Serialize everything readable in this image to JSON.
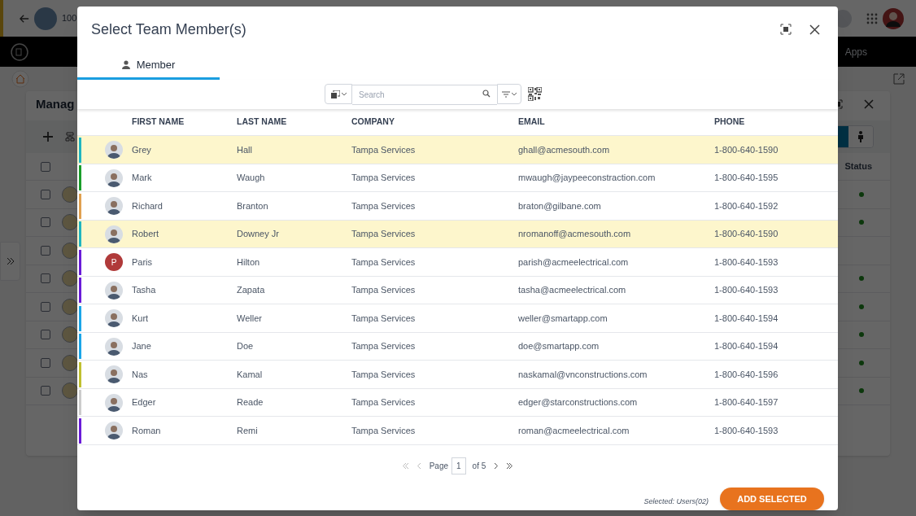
{
  "backdrop": {
    "header_text": "100",
    "nav_text": "Apps",
    "page_title": "Manag",
    "status_heading": "Status",
    "view_modes": [
      {
        "selected": true
      },
      {
        "selected": false
      }
    ],
    "all_checked": false,
    "rows": [
      {
        "checked": false,
        "status": true
      },
      {
        "checked": false,
        "status": true
      },
      {
        "checked": false,
        "status": false
      },
      {
        "checked": false,
        "status": true
      },
      {
        "checked": false,
        "status": true
      },
      {
        "checked": false,
        "status": true
      },
      {
        "checked": false,
        "status": true
      },
      {
        "checked": false,
        "status": true
      }
    ]
  },
  "dialog": {
    "title": "Select Team Member(s)",
    "tabs": [
      {
        "label": "Member",
        "selected": true
      }
    ],
    "search": {
      "placeholder": "Search"
    },
    "columns": [
      "FIRST NAME",
      "LAST NAME",
      "COMPANY",
      "EMAIL",
      "PHONE"
    ],
    "rows": [
      {
        "first": "Grey",
        "last": "Hall",
        "company": "Tampa Services",
        "email": "ghall@acmesouth.com",
        "phone": "1-800-640-1590",
        "selected": true,
        "color": "#1fb5c0",
        "kind": "photo"
      },
      {
        "first": "Mark",
        "last": "Waugh",
        "company": "Tampa Services",
        "email": "mwaugh@jaypeeconstraction.com",
        "phone": "1-800-640-1595",
        "selected": false,
        "color": "#1a9e2a",
        "kind": "photo"
      },
      {
        "first": "Richard",
        "last": "Branton",
        "company": "Tampa Services",
        "email": "braton@gilbane.com",
        "phone": "1-800-640-1592",
        "selected": false,
        "color": "#e0a050",
        "kind": "photo"
      },
      {
        "first": "Robert",
        "last": "Downey Jr",
        "company": "Tampa Services",
        "email": "nromanoff@acmesouth.com",
        "phone": "1-800-640-1590",
        "selected": true,
        "color": "#1fb5c0",
        "kind": "photo"
      },
      {
        "first": "Paris",
        "last": "Hilton",
        "company": "Tampa Services",
        "email": "parish@acmeelectrical.com",
        "phone": "1-800-640-1593",
        "selected": false,
        "color": "#6a1bd8",
        "kind": "initial",
        "initial": "P"
      },
      {
        "first": "Tasha",
        "last": "Zapata",
        "company": "Tampa Services",
        "email": "tasha@acmeelectrical.com",
        "phone": "1-800-640-1593",
        "selected": false,
        "color": "#6a1bd8",
        "kind": "photo"
      },
      {
        "first": "Kurt",
        "last": "Weller",
        "company": "Tampa Services",
        "email": "weller@smartapp.com",
        "phone": "1-800-640-1594",
        "selected": false,
        "color": "#1aa5e8",
        "kind": "photo"
      },
      {
        "first": "Jane",
        "last": "Doe",
        "company": "Tampa Services",
        "email": "doe@smartapp.com",
        "phone": "1-800-640-1594",
        "selected": false,
        "color": "#1aa5e8",
        "kind": "photo"
      },
      {
        "first": "Nas",
        "last": "Kamal",
        "company": "Tampa Services",
        "email": "naskamal@vnconstructions.com",
        "phone": "1-800-640-1596",
        "selected": false,
        "color": "#c0c030",
        "kind": "photo"
      },
      {
        "first": "Edger",
        "last": "Reade",
        "company": "Tampa Services",
        "email": "edger@starconstructions.com",
        "phone": "1-800-640-1597",
        "selected": false,
        "color": "#cccccc",
        "kind": "photo"
      },
      {
        "first": "Roman",
        "last": "Remi",
        "company": "Tampa Services",
        "email": "roman@acmeelectrical.com",
        "phone": "1-800-640-1593",
        "selected": false,
        "color": "#6a1bd8",
        "kind": "photo"
      }
    ],
    "pagination": {
      "page_label": "Page",
      "page": "1",
      "of_label": "of",
      "total": "5"
    },
    "selection_note": "Selected: Users(02)",
    "add_button": "ADD SELECTED"
  }
}
